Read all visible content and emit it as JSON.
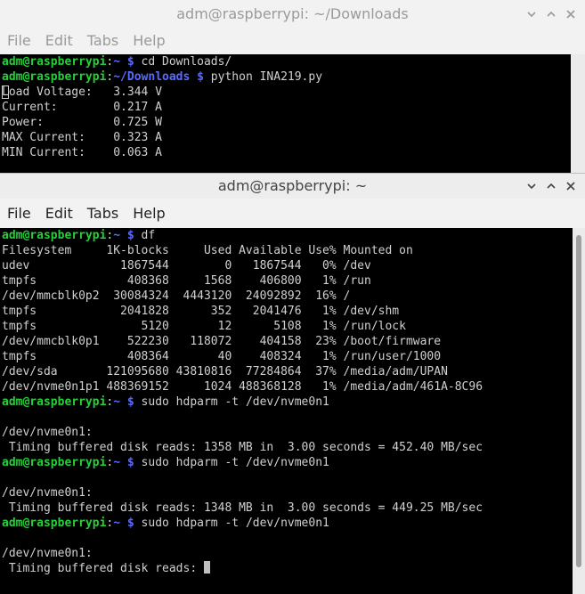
{
  "back_window": {
    "title": "adm@raspberrypi: ~/Downloads",
    "menu": [
      "File",
      "Edit",
      "Tabs",
      "Help"
    ],
    "lines": [
      [
        {
          "t": "adm@raspberrypi",
          "c": "u"
        },
        {
          "t": ":",
          "c": ""
        },
        {
          "t": "~ $",
          "c": "p"
        },
        {
          "t": " cd Downloads/",
          "c": ""
        }
      ],
      [
        {
          "t": "adm@raspberrypi",
          "c": "u"
        },
        {
          "t": ":",
          "c": ""
        },
        {
          "t": "~/Downloads $",
          "c": "p"
        },
        {
          "t": " python INA219.py",
          "c": ""
        }
      ],
      [
        {
          "t": "Load Voltage:   3.344 V",
          "c": "first-cursor"
        }
      ],
      [
        {
          "t": "Current:        0.217 A",
          "c": ""
        }
      ],
      [
        {
          "t": "Power:          0.725 W",
          "c": ""
        }
      ],
      [
        {
          "t": "MAX Current:    0.323 A",
          "c": ""
        }
      ],
      [
        {
          "t": "MIN Current:    0.063 A",
          "c": ""
        }
      ]
    ]
  },
  "front_window": {
    "title": "adm@raspberrypi: ~",
    "menu": [
      "File",
      "Edit",
      "Tabs",
      "Help"
    ],
    "lines": [
      [
        {
          "t": "adm@raspberrypi",
          "c": "u"
        },
        {
          "t": ":",
          "c": ""
        },
        {
          "t": "~ $",
          "c": "p"
        },
        {
          "t": " df",
          "c": ""
        }
      ],
      [
        {
          "t": "Filesystem     1K-blocks     Used Available Use% Mounted on",
          "c": ""
        }
      ],
      [
        {
          "t": "udev             1867544        0   1867544   0% /dev",
          "c": ""
        }
      ],
      [
        {
          "t": "tmpfs             408368     1568    406800   1% /run",
          "c": ""
        }
      ],
      [
        {
          "t": "/dev/mmcblk0p2  30084324  4443120  24092892  16% /",
          "c": ""
        }
      ],
      [
        {
          "t": "tmpfs            2041828      352   2041476   1% /dev/shm",
          "c": ""
        }
      ],
      [
        {
          "t": "tmpfs               5120       12      5108   1% /run/lock",
          "c": ""
        }
      ],
      [
        {
          "t": "/dev/mmcblk0p1    522230   118072    404158  23% /boot/firmware",
          "c": ""
        }
      ],
      [
        {
          "t": "tmpfs             408364       40    408324   1% /run/user/1000",
          "c": ""
        }
      ],
      [
        {
          "t": "/dev/sda       121095680 43810816  77284864  37% /media/adm/UPAN",
          "c": ""
        }
      ],
      [
        {
          "t": "/dev/nvme0n1p1 488369152     1024 488368128   1% /media/adm/461A-8C96",
          "c": ""
        }
      ],
      [
        {
          "t": "adm@raspberrypi",
          "c": "u"
        },
        {
          "t": ":",
          "c": ""
        },
        {
          "t": "~ $",
          "c": "p"
        },
        {
          "t": " sudo hdparm -t /dev/nvme0n1",
          "c": ""
        }
      ],
      [
        {
          "t": "",
          "c": ""
        }
      ],
      [
        {
          "t": "/dev/nvme0n1:",
          "c": ""
        }
      ],
      [
        {
          "t": " Timing buffered disk reads: 1358 MB in  3.00 seconds = 452.40 MB/sec",
          "c": ""
        }
      ],
      [
        {
          "t": "adm@raspberrypi",
          "c": "u"
        },
        {
          "t": ":",
          "c": ""
        },
        {
          "t": "~ $",
          "c": "p"
        },
        {
          "t": " sudo hdparm -t /dev/nvme0n1",
          "c": ""
        }
      ],
      [
        {
          "t": "",
          "c": ""
        }
      ],
      [
        {
          "t": "/dev/nvme0n1:",
          "c": ""
        }
      ],
      [
        {
          "t": " Timing buffered disk reads: 1348 MB in  3.00 seconds = 449.25 MB/sec",
          "c": ""
        }
      ],
      [
        {
          "t": "adm@raspberrypi",
          "c": "u"
        },
        {
          "t": ":",
          "c": ""
        },
        {
          "t": "~ $",
          "c": "p"
        },
        {
          "t": " sudo hdparm -t /dev/nvme0n1",
          "c": ""
        }
      ],
      [
        {
          "t": "",
          "c": ""
        }
      ],
      [
        {
          "t": "/dev/nvme0n1:",
          "c": ""
        }
      ],
      [
        {
          "t": " Timing buffered disk reads: ",
          "c": ""
        },
        {
          "t": "",
          "c": "cursor"
        }
      ]
    ]
  },
  "colors": {
    "user_host": "#26d03a",
    "path_prompt": "#5a6bff",
    "terminal_bg": "#000000"
  }
}
